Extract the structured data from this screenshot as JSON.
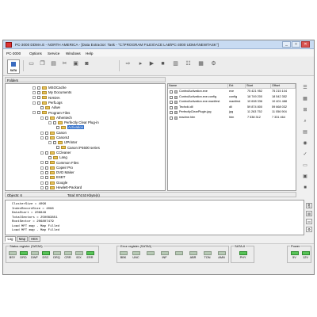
{
  "window": {
    "title": "PC-3000 DDMA.E - NORTH AMERICA - [Data Extractor: Task - \"C:\\PROGRAM FILES\\ACE LAB\\PC-3000 UDMA\\NEWTASK\"]",
    "buttons": {
      "minimize": "_",
      "maximize": "□",
      "close": "✕"
    }
  },
  "menubar": {
    "items": [
      "PC-3000",
      "Options",
      "Service",
      "Windows",
      "Help"
    ]
  },
  "toolbar": {
    "sata_label": "SATA",
    "icons": [
      "floppy-icon",
      "copy-icon",
      "open-icon",
      "cut-icon",
      "paste-icon",
      "disk-icon",
      "export-icon",
      "arrow-right-icon",
      "play-icon",
      "stop-icon",
      "book-icon",
      "tree-icon",
      "grid-icon",
      "settings-icon"
    ]
  },
  "folders": {
    "header": "Folders",
    "items": [
      {
        "label": "MSOCache",
        "depth": 0
      },
      {
        "label": "My Documents",
        "depth": 0
      },
      {
        "label": "NVIDIA",
        "depth": 0
      },
      {
        "label": "PerfLogs",
        "depth": 0
      },
      {
        "label": "Adwe",
        "depth": 1
      },
      {
        "label": "Program Files",
        "depth": 0
      },
      {
        "label": "Athentech",
        "depth": 1
      },
      {
        "label": "Perfectly Clear Plug-in",
        "depth": 2
      },
      {
        "label": "Activation",
        "depth": 3,
        "selected": true
      },
      {
        "label": "Canon",
        "depth": 1
      },
      {
        "label": "CanonIJ",
        "depth": 1
      },
      {
        "label": "IJPrinter",
        "depth": 2
      },
      {
        "label": "Canon iP4600 series",
        "depth": 3
      },
      {
        "label": "CCleaner",
        "depth": 1
      },
      {
        "label": "Lang",
        "depth": 2
      },
      {
        "label": "Common Files",
        "depth": 1
      },
      {
        "label": "Copeir Pro",
        "depth": 1
      },
      {
        "label": "DVD Maker",
        "depth": 1
      },
      {
        "label": "ESET",
        "depth": 1
      },
      {
        "label": "Google",
        "depth": 1
      },
      {
        "label": "Hewlett-Packard",
        "depth": 1
      }
    ]
  },
  "files": {
    "columns": [
      "Name",
      "Ext",
      "Start",
      "Offset"
    ],
    "rows": [
      {
        "name": "ControlActivation.exe",
        "ext": "exe",
        "start": "75 421 952",
        "offset": "75 215 104"
      },
      {
        "name": "ControlActivation.exe.config",
        "ext": "config",
        "start": "18 749 200",
        "offset": "18 542 352"
      },
      {
        "name": "ControlActivation.exe.manifest",
        "ext": "manifest",
        "start": "10 608 336",
        "offset": "10 401 488"
      },
      {
        "name": "Techcki.dll",
        "ext": "dll",
        "start": "59 874 800",
        "offset": "59 668 032"
      },
      {
        "name": "PerfectlyClearPlugin.jpg",
        "ext": "jpg",
        "start": "11 263 752",
        "offset": "11 056 904"
      },
      {
        "name": "readme.htm",
        "ext": "htm",
        "start": "7 538 312",
        "offset": "7 331 464"
      }
    ]
  },
  "objects_bar": {
    "left": "Objects: 6",
    "right": "Total: 874,53 Kbyte(s)"
  },
  "log": {
    "lines": [
      "ClusterSize = 4096",
      "IndexRecordSize = 4096",
      "DataStart = 206848",
      "TotalSectors = 250083851",
      "RootSector = 206807479",
      "Load MFT map - Map Filled",
      "Load MFT map - Map Filled"
    ]
  },
  "tabs": [
    "Log",
    "Map",
    "HEX"
  ],
  "status": {
    "groups": [
      {
        "title": "Status register (SATA0)",
        "leds": [
          "BSY",
          "DRD",
          "DWF",
          "DSC",
          "DRQ",
          "CRR",
          "IDX",
          "ERR"
        ],
        "on": [
          1,
          3,
          7
        ]
      },
      {
        "title": "Error register (SATA0)",
        "leds": [
          "BBK",
          "UNC",
          "",
          "INF",
          "",
          "ABR",
          "TON",
          "AMN"
        ],
        "on": []
      },
      {
        "title": "SATA-II",
        "leds": [
          "PHY"
        ],
        "on": [
          0
        ]
      },
      {
        "title": "Power",
        "leds": [
          "5V",
          "12V"
        ],
        "on": [
          0,
          1
        ]
      }
    ]
  },
  "colors": {
    "titlebar": "#c8dbf2",
    "selection": "#2f6ec9",
    "led_on": "#58c458",
    "led_off": "#b7c9b5"
  }
}
